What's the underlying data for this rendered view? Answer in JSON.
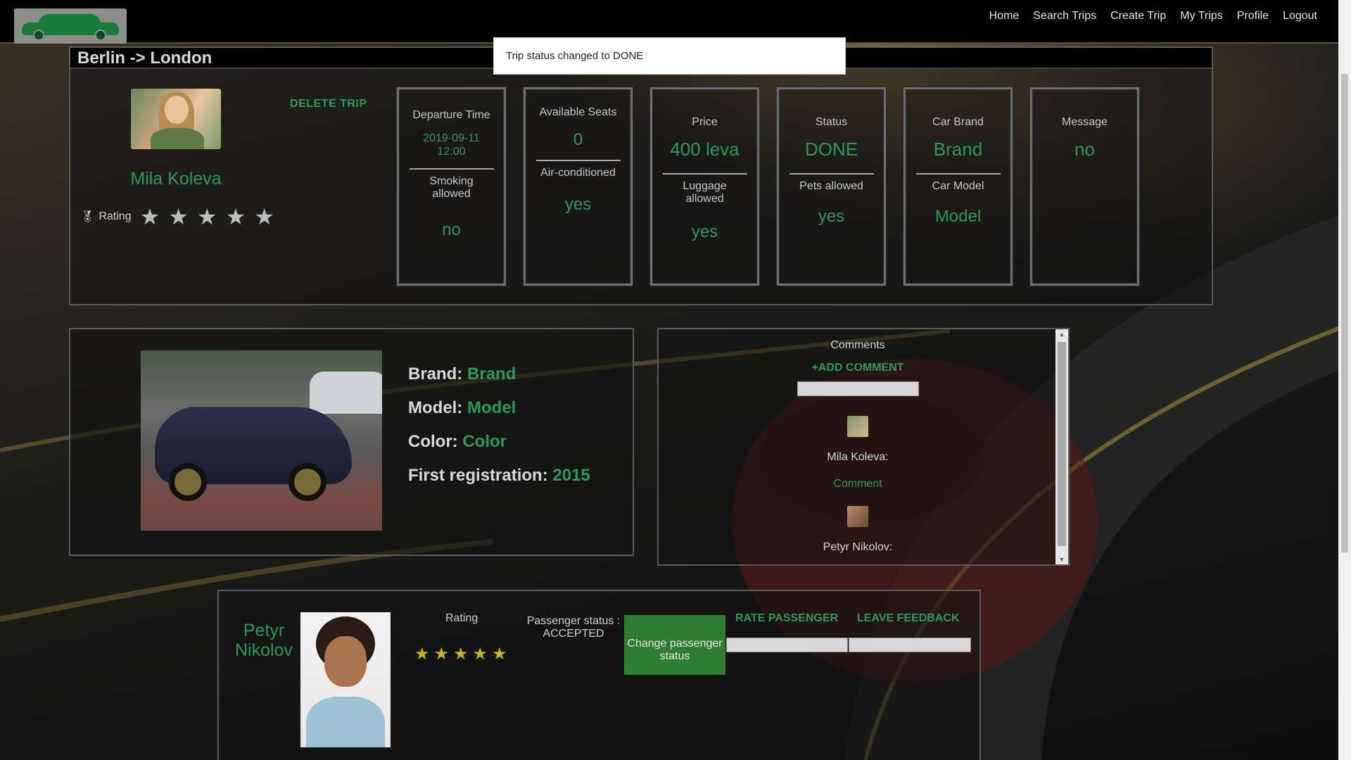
{
  "navbar": {
    "links": [
      "Home",
      "Search Trips",
      "Create Trip",
      "My Trips",
      "Profile",
      "Logout"
    ]
  },
  "toast": {
    "message": "Trip status changed to DONE"
  },
  "trip": {
    "title": "Berlin -> London",
    "delete_label": "DELETE TRIP",
    "driver": {
      "name": "Mila Koleva",
      "rating_label": "Rating",
      "rating_stars": 5,
      "rating_value": 0
    },
    "details": {
      "departure_label": "Departure Time",
      "departure_value": "2019-09-11 12:00",
      "smoking_label": "Smoking allowed",
      "smoking_value": "no",
      "seats_label": "Available Seats",
      "seats_value": "0",
      "ac_label": "Air-conditioned",
      "ac_value": "yes",
      "price_label": "Price",
      "price_value": "400 leva",
      "luggage_label": "Luggage allowed",
      "luggage_value": "yes",
      "status_label": "Status",
      "status_value": "DONE",
      "pets_label": "Pets allowed",
      "pets_value": "yes",
      "brand_label": "Car Brand",
      "brand_value": "Brand",
      "model_label": "Car Model",
      "model_value": "Model",
      "message_label": "Message",
      "message_value": "no"
    }
  },
  "car": {
    "brand_label": "Brand:",
    "brand_value": "Brand",
    "model_label": "Model:",
    "model_value": "Model",
    "color_label": "Color:",
    "color_value": "Color",
    "reg_label": "First registration:",
    "reg_value": "2015"
  },
  "comments": {
    "title": "Comments",
    "add_label": "+ADD COMMENT",
    "items": [
      {
        "author": "Mila Koleva:",
        "text": "Comment"
      },
      {
        "author": "Petyr Nikolov:",
        "text": ""
      }
    ]
  },
  "passenger": {
    "name": "Petyr Nikolov",
    "rating_label": "Rating",
    "rating_value": 5,
    "status_text": "Passenger status : ACCEPTED",
    "change_status_label": "Change passenger status",
    "rate_label": "RATE PASSENGER",
    "feedback_label": "LEAVE FEEDBACK"
  },
  "colors": {
    "accent": "#2e9a5a",
    "button_green": "#2e7d32",
    "star_gold": "#c9b319",
    "navbar_bg": "#000000"
  },
  "icons": {
    "rating": "medal-icon",
    "star": "star-icon"
  }
}
